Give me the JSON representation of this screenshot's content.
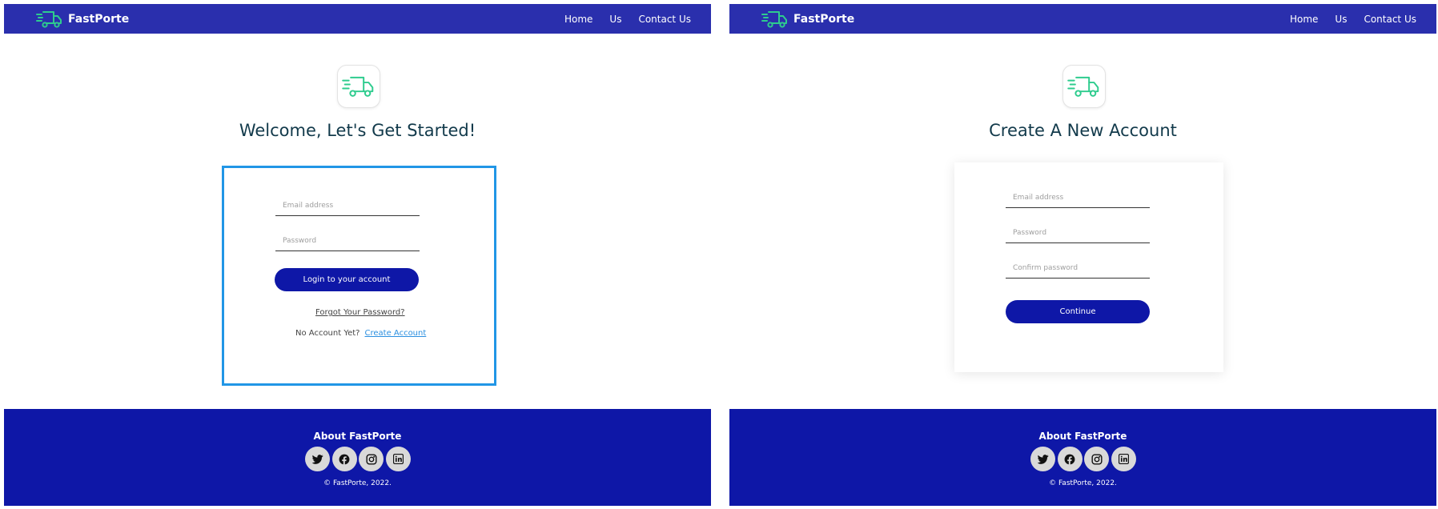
{
  "brand": {
    "name": "FastPorte",
    "accent": "#2ecc8e",
    "nav_color": "#2a2fad",
    "footer_color": "#0e17a7",
    "button_color": "#0e17a7"
  },
  "nav": {
    "items": [
      "Home",
      "Us",
      "Contact Us"
    ]
  },
  "login": {
    "heading": "Welcome, Let's Get Started!",
    "email_placeholder": "Email address",
    "password_placeholder": "Password",
    "submit_label": "Login to your account",
    "forgot_label": "Forgot Your Password?",
    "no_account_label": "No Account Yet?",
    "create_label": "Create Account"
  },
  "signup": {
    "heading": "Create A New Account",
    "email_placeholder": "Email address",
    "password_placeholder": "Password",
    "confirm_placeholder": "Confirm password",
    "submit_label": "Continue"
  },
  "footer": {
    "title": "About FastPorte",
    "socials": [
      "twitter-icon",
      "facebook-icon",
      "instagram-icon",
      "linkedin-icon"
    ],
    "copyright": "© FastPorte, 2022."
  }
}
